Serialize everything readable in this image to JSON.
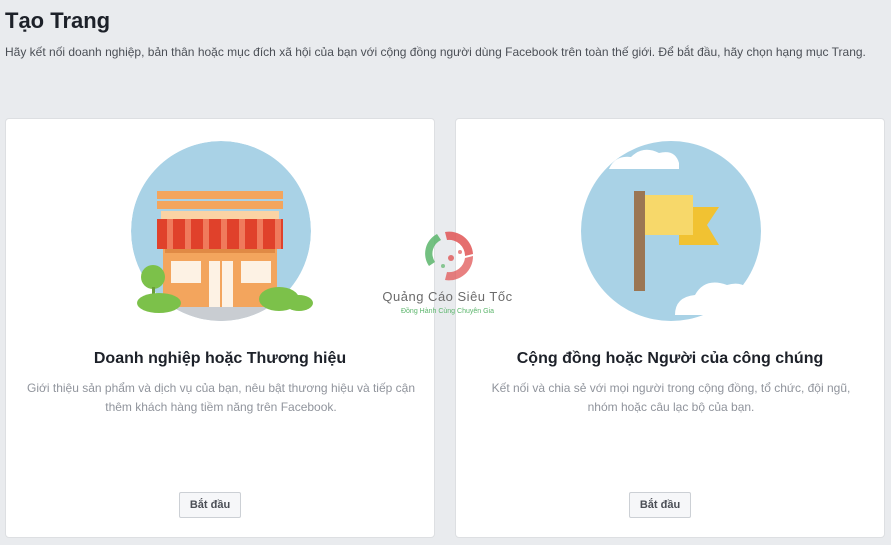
{
  "header": {
    "title": "Tạo Trang",
    "description": "Hãy kết nối doanh nghiệp, bản thân hoặc mục đích xã hội của bạn với cộng đồng người dùng Facebook trên toàn thế giới. Để bắt đầu, hãy chọn hạng mục Trang."
  },
  "cards": [
    {
      "title": "Doanh nghiệp hoặc Thương hiệu",
      "description": "Giới thiệu sản phẩm và dịch vụ của bạn, nêu bật thương hiệu và tiếp cận thêm khách hàng tiềm năng trên Facebook.",
      "button_label": "Bắt đầu",
      "icon": "storefront-icon"
    },
    {
      "title": "Cộng đồng hoặc Người của công chúng",
      "description": "Kết nối và chia sẻ với mọi người trong cộng đồng, tổ chức, đội ngũ, nhóm hoặc câu lạc bộ của bạn.",
      "button_label": "Bắt đầu",
      "icon": "flag-icon"
    }
  ],
  "watermark": {
    "name": "Quảng Cáo Siêu Tốc",
    "tagline": "Đồng Hành Cùng Chuyên Gia"
  },
  "colors": {
    "background": "#e9ebee",
    "sky": "#a9d2e6",
    "awning_red": "#e0412b",
    "store_orange": "#f3a55d",
    "flag_yellow": "#f7d86a",
    "flag_yellow_dark": "#f1c232",
    "pole_brown": "#9b7653",
    "bush_green": "#7cc14a"
  }
}
